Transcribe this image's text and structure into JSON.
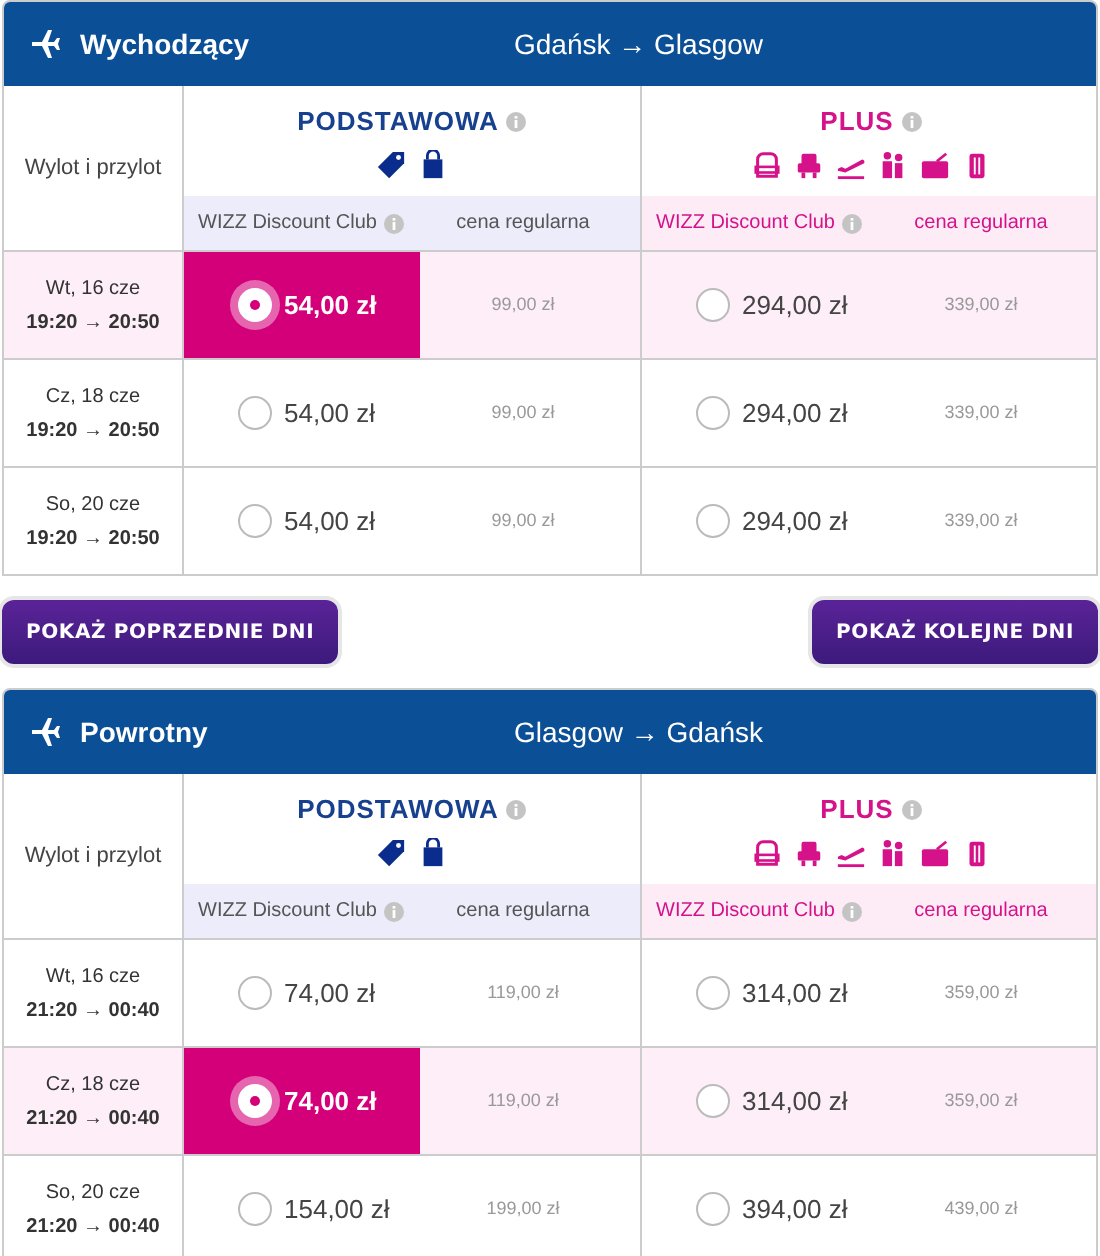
{
  "sections": [
    {
      "title": "Wychodzący",
      "route": "Gdańsk → Glasgow",
      "date_header": "Wylot i przylot",
      "tiers": [
        {
          "name": "PODSTAWOWA",
          "kind": "basic",
          "discount_label": "WIZZ Discount Club",
          "regular_label": "cena regularna"
        },
        {
          "name": "PLUS",
          "kind": "plus",
          "discount_label": "WIZZ Discount Club",
          "regular_label": "cena regularna"
        }
      ],
      "rows": [
        {
          "date": "Wt, 16 cze",
          "times": "19:20 → 20:50",
          "fares": [
            {
              "price": "54,00 zł",
              "regular": "99,00 zł",
              "selected": true
            },
            {
              "price": "294,00 zł",
              "regular": "339,00 zł",
              "selected": false
            }
          ]
        },
        {
          "date": "Cz, 18 cze",
          "times": "19:20 → 20:50",
          "fares": [
            {
              "price": "54,00 zł",
              "regular": "99,00 zł",
              "selected": false
            },
            {
              "price": "294,00 zł",
              "regular": "339,00 zł",
              "selected": false
            }
          ]
        },
        {
          "date": "So, 20 cze",
          "times": "19:20 → 20:50",
          "fares": [
            {
              "price": "54,00 zł",
              "regular": "99,00 zł",
              "selected": false
            },
            {
              "price": "294,00 zł",
              "regular": "339,00 zł",
              "selected": false
            }
          ]
        }
      ],
      "buttons": [
        "POKAŻ POPRZEDNIE DNI",
        "POKAŻ KOLEJNE DNI"
      ]
    },
    {
      "title": "Powrotny",
      "route": "Glasgow → Gdańsk",
      "date_header": "Wylot i przylot",
      "tiers": [
        {
          "name": "PODSTAWOWA",
          "kind": "basic",
          "discount_label": "WIZZ Discount Club",
          "regular_label": "cena regularna"
        },
        {
          "name": "PLUS",
          "kind": "plus",
          "discount_label": "WIZZ Discount Club",
          "regular_label": "cena regularna"
        }
      ],
      "rows": [
        {
          "date": "Wt, 16 cze",
          "times": "21:20 → 00:40",
          "fares": [
            {
              "price": "74,00 zł",
              "regular": "119,00 zł",
              "selected": false
            },
            {
              "price": "314,00 zł",
              "regular": "359,00 zł",
              "selected": false
            }
          ]
        },
        {
          "date": "Cz, 18 cze",
          "times": "21:20 → 00:40",
          "fares": [
            {
              "price": "74,00 zł",
              "regular": "119,00 zł",
              "selected": true
            },
            {
              "price": "314,00 zł",
              "regular": "359,00 zł",
              "selected": false
            }
          ]
        },
        {
          "date": "So, 20 cze",
          "times": "21:20 → 00:40",
          "fares": [
            {
              "price": "154,00 zł",
              "regular": "199,00 zł",
              "selected": false
            },
            {
              "price": "394,00 zł",
              "regular": "439,00 zł",
              "selected": false
            }
          ]
        }
      ]
    }
  ]
}
